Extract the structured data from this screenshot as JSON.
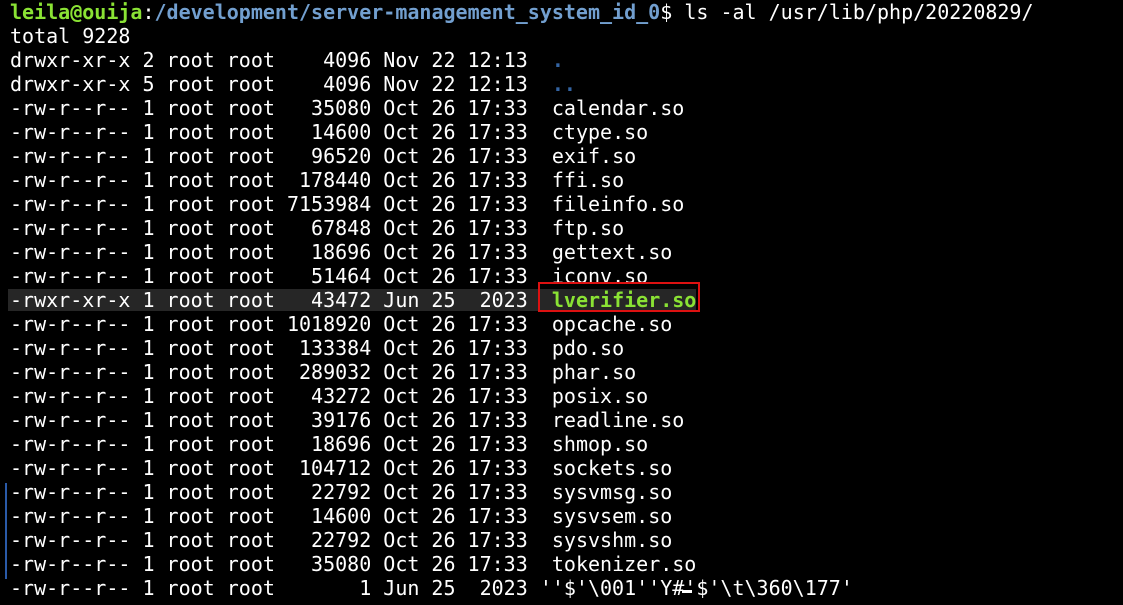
{
  "prompt": {
    "user_host": "leila@ouija",
    "colon": ":",
    "path": "/development/server-management_system_id_0",
    "sign": "$ ",
    "command": "ls -al /usr/lib/php/20220829/"
  },
  "total_line": "total 9228",
  "entries": [
    {
      "meta": "drwxr-xr-x 2 root root    4096 Nov 22 12:13  ",
      "name": ".",
      "kind": "dir"
    },
    {
      "meta": "drwxr-xr-x 5 root root    4096 Nov 22 12:13  ",
      "name": "..",
      "kind": "dir"
    },
    {
      "meta": "-rw-r--r-- 1 root root   35080 Oct 26 17:33  ",
      "name": "calendar.so",
      "kind": "file"
    },
    {
      "meta": "-rw-r--r-- 1 root root   14600 Oct 26 17:33  ",
      "name": "ctype.so",
      "kind": "file"
    },
    {
      "meta": "-rw-r--r-- 1 root root   96520 Oct 26 17:33  ",
      "name": "exif.so",
      "kind": "file"
    },
    {
      "meta": "-rw-r--r-- 1 root root  178440 Oct 26 17:33  ",
      "name": "ffi.so",
      "kind": "file"
    },
    {
      "meta": "-rw-r--r-- 1 root root 7153984 Oct 26 17:33  ",
      "name": "fileinfo.so",
      "kind": "file"
    },
    {
      "meta": "-rw-r--r-- 1 root root   67848 Oct 26 17:33  ",
      "name": "ftp.so",
      "kind": "file"
    },
    {
      "meta": "-rw-r--r-- 1 root root   18696 Oct 26 17:33  ",
      "name": "gettext.so",
      "kind": "file"
    },
    {
      "meta": "-rw-r--r-- 1 root root   51464 Oct 26 17:33  ",
      "name": "iconv.so",
      "kind": "file"
    },
    {
      "meta": "-rwxr-xr-x 1 root root   43472 Jun 25  2023  ",
      "name": "lverifier.so",
      "kind": "exe"
    },
    {
      "meta": "-rw-r--r-- 1 root root 1018920 Oct 26 17:33  ",
      "name": "opcache.so",
      "kind": "file"
    },
    {
      "meta": "-rw-r--r-- 1 root root  133384 Oct 26 17:33  ",
      "name": "pdo.so",
      "kind": "file"
    },
    {
      "meta": "-rw-r--r-- 1 root root  289032 Oct 26 17:33  ",
      "name": "phar.so",
      "kind": "file"
    },
    {
      "meta": "-rw-r--r-- 1 root root   43272 Oct 26 17:33  ",
      "name": "posix.so",
      "kind": "file"
    },
    {
      "meta": "-rw-r--r-- 1 root root   39176 Oct 26 17:33  ",
      "name": "readline.so",
      "kind": "file"
    },
    {
      "meta": "-rw-r--r-- 1 root root   18696 Oct 26 17:33  ",
      "name": "shmop.so",
      "kind": "file"
    },
    {
      "meta": "-rw-r--r-- 1 root root  104712 Oct 26 17:33  ",
      "name": "sockets.so",
      "kind": "file"
    },
    {
      "meta": "-rw-r--r-- 1 root root   22792 Oct 26 17:33  ",
      "name": "sysvmsg.so",
      "kind": "file"
    },
    {
      "meta": "-rw-r--r-- 1 root root   14600 Oct 26 17:33  ",
      "name": "sysvsem.so",
      "kind": "file"
    },
    {
      "meta": "-rw-r--r-- 1 root root   22792 Oct 26 17:33  ",
      "name": "sysvshm.so",
      "kind": "file"
    },
    {
      "meta": "-rw-r--r-- 1 root root   35080 Oct 26 17:33  ",
      "name": "tokenizer.so",
      "kind": "file"
    },
    {
      "meta": "-rw-r--r-- 1 root root       1 Jun 25  2023 ",
      "name": "''$'\\001''Y#'$'\\t\\360\\177'",
      "kind": "file"
    }
  ],
  "highlighted_entry": "lverifier.so",
  "colors": {
    "background": "#000000",
    "prompt_user": "#8ae234",
    "prompt_path": "#729fcf",
    "directory": "#3465a4",
    "executable": "#8ae234",
    "annotation": "#dd1111"
  }
}
